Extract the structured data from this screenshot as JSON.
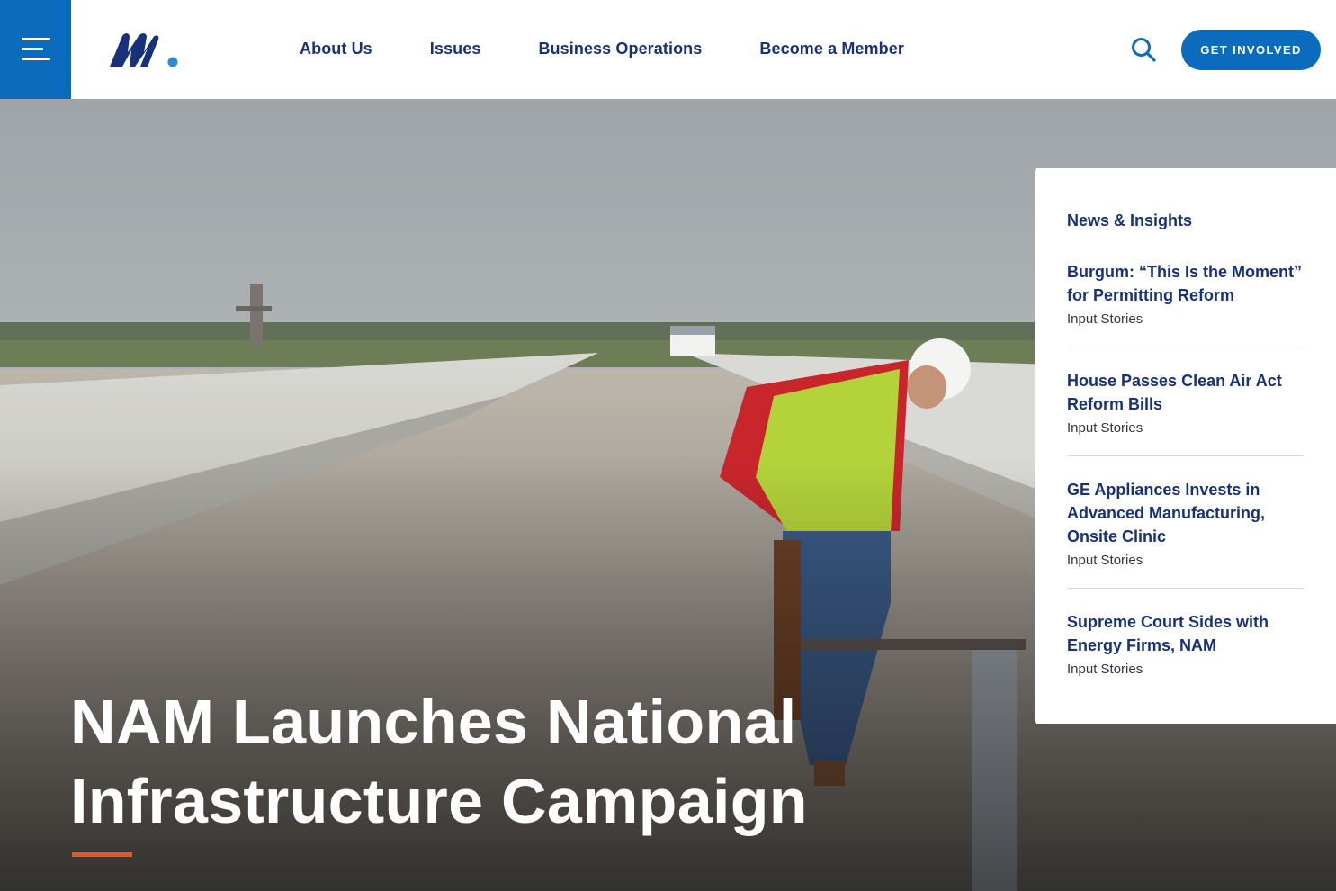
{
  "header": {
    "menu_icon": "hamburger-icon",
    "logo_icon": "nam-logo-icon",
    "nav": [
      {
        "label": "About Us"
      },
      {
        "label": "Issues"
      },
      {
        "label": "Business Operations"
      },
      {
        "label": "Become a Member"
      }
    ],
    "search_icon": "search-icon",
    "cta_label": "GET INVOLVED"
  },
  "hero": {
    "title_line1": "NAM Launches National",
    "title_line2": "Infrastructure Campaign",
    "accent_color": "#e25b26"
  },
  "news": {
    "title": "News & Insights",
    "items": [
      {
        "title": "Burgum: “This Is the Moment” for Permitting Reform",
        "source": "Input Stories"
      },
      {
        "title": "House Passes Clean Air Act Reform Bills",
        "source": "Input Stories"
      },
      {
        "title": "GE Appliances Invests in Advanced Manufacturing, Onsite Clinic",
        "source": "Input Stories"
      },
      {
        "title": "Supreme Court Sides with Energy Firms, NAM",
        "source": "Input Stories"
      }
    ]
  },
  "colors": {
    "brand_blue": "#0b6cbd",
    "navy": "#17317a"
  }
}
